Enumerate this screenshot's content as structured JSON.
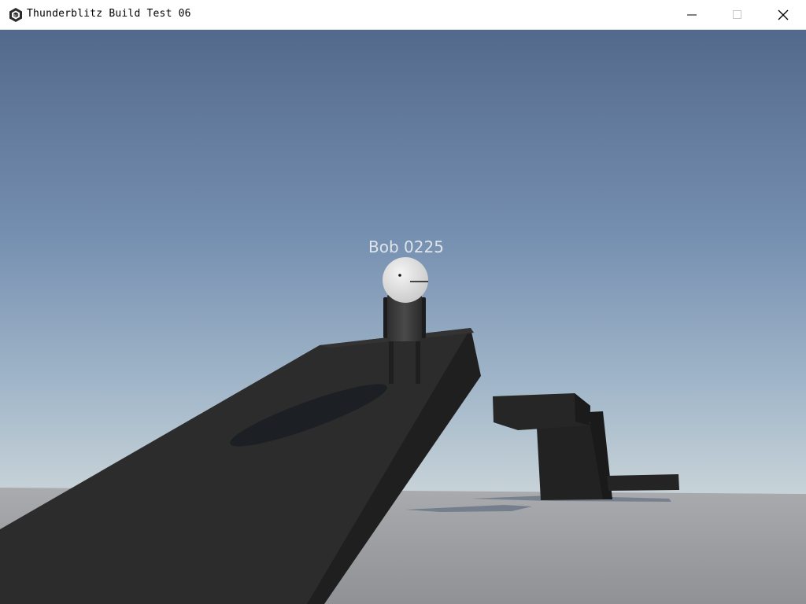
{
  "window": {
    "title": "Thunderblitz Build Test 06",
    "icon": "unity-logo-icon",
    "controls": [
      "minimize-icon",
      "maximize-icon",
      "close-icon"
    ]
  },
  "scene": {
    "player_name": "Bob 0225",
    "colors": {
      "sky_top": "#53698b",
      "sky_mid": "#7d97b6",
      "sky_horizon": "#c5d1d8",
      "ground": "#9a9da2",
      "ramp": "#2c2c2c",
      "block": "#262626"
    }
  }
}
